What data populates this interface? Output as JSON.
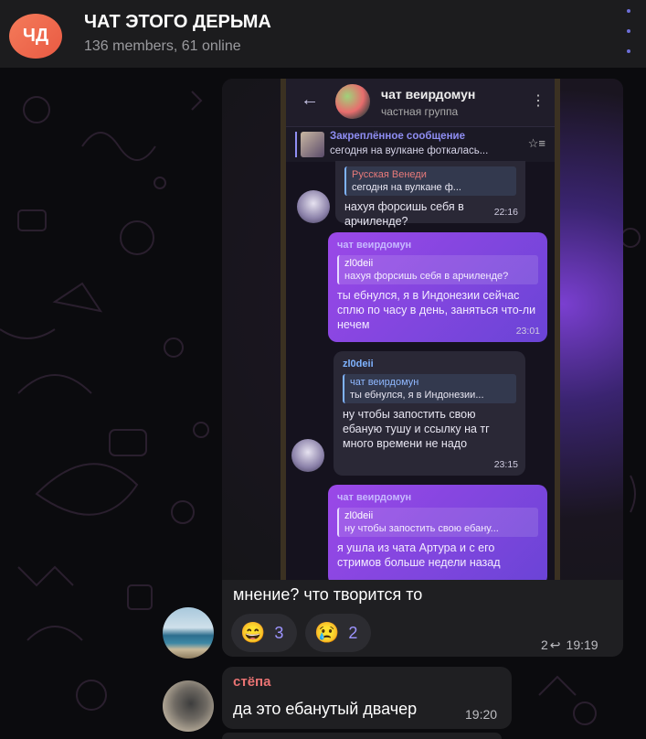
{
  "chat": {
    "avatar_initials": "ЧД",
    "title": "ЧАТ ЭТОГО ДЕРЬМА",
    "subtitle": "136 members, 61 online"
  },
  "post": {
    "photo": {
      "channel_name": "чат веирдомун",
      "channel_sub": "частная группа",
      "pinned_label": "Закреплённое сообщение",
      "pinned_text": "сегодня на вулкане фоткалась...",
      "messages": [
        {
          "dir": "in",
          "quote_name": "Русская Венеди",
          "quote_text": "сегодня на вулкане ф...",
          "text": "нахуя форсишь себя в арчиленде?",
          "time": "22:16"
        },
        {
          "dir": "out",
          "who": "чат веирдомун",
          "quote_name": "zl0deii",
          "quote_text": "нахуя форсишь себя в арчиленде?",
          "text": "ты ебнулся, я в Индонезии сейчас сплю по часу в день, заняться что-ли нечем",
          "time": "23:01"
        },
        {
          "dir": "in",
          "who": "zl0deii",
          "quote_name": "чат веирдомун",
          "quote_text": "ты ебнулся, я в Индонезии...",
          "text": "ну чтобы запостить свою ебаную тушу и ссылку на тг много времени не надо",
          "time": "23:15"
        },
        {
          "dir": "out",
          "who": "чат веирдомун",
          "quote_name": "zl0deii",
          "quote_text": "ну чтобы запостить свою ебану...",
          "text": "я ушла из чата Артура и с его стримов больше недели назад",
          "time": ""
        }
      ]
    },
    "caption": "мнение? что творится то",
    "reactions": [
      {
        "emoji": "😄",
        "count": "3"
      },
      {
        "emoji": "😢",
        "count": "2"
      }
    ],
    "replies": "2",
    "time": "19:19"
  },
  "message2": {
    "sender": "стёпа",
    "text": "да это ебанутый двачер",
    "time": "19:20"
  }
}
